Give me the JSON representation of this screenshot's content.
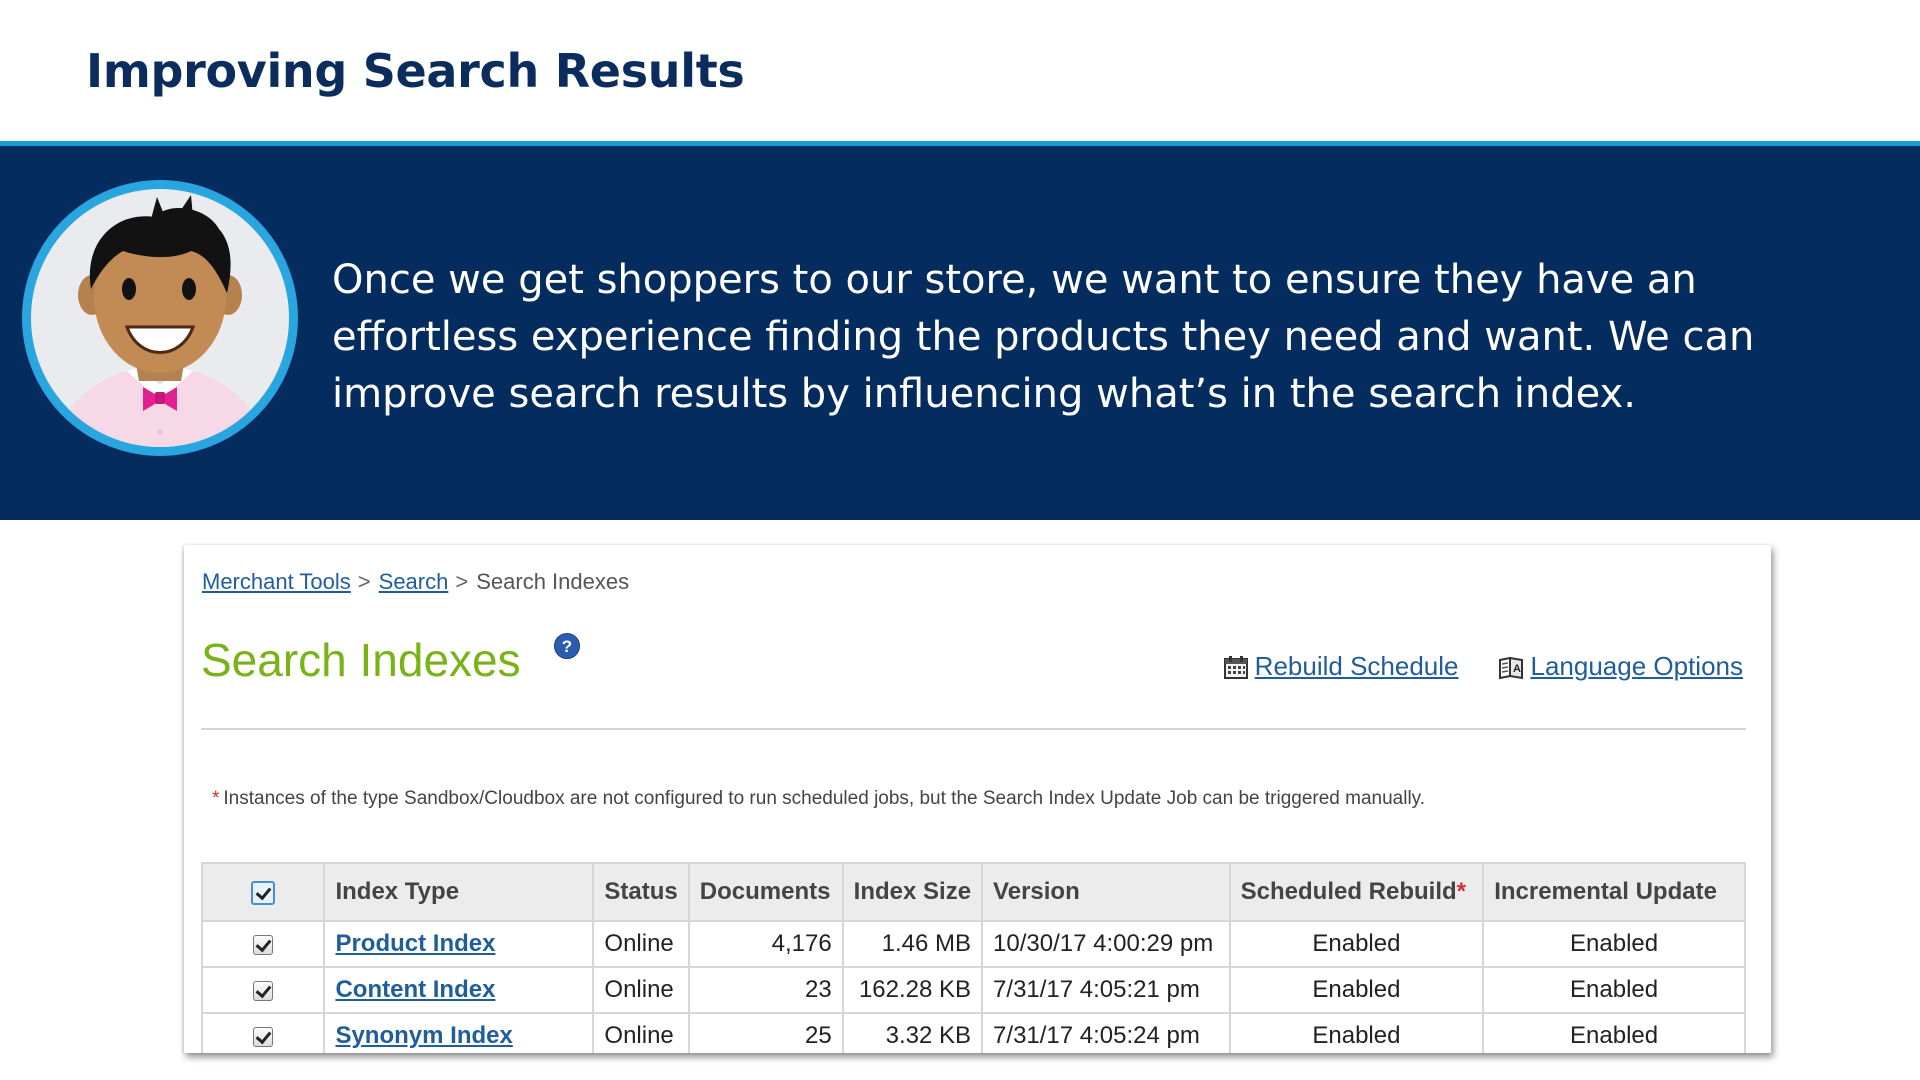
{
  "slide": {
    "title": "Improving Search Results",
    "banner_text": "Once we get shoppers to our store, we want to ensure they have an effortless experience finding the products they need and want. We can improve search results by influencing what’s in the search index."
  },
  "panel": {
    "breadcrumb": {
      "items": [
        "Merchant Tools",
        "Search"
      ],
      "current": "Search Indexes",
      "separator": ">"
    },
    "page_title": "Search Indexes",
    "help_icon": "?",
    "links": {
      "rebuild_schedule": "Rebuild Schedule",
      "rebuild_icon": "calendar-icon",
      "language_options": "Language Options",
      "language_icon": "language-book-icon"
    },
    "note_star": "*",
    "note": "Instances of the type Sandbox/Cloudbox are not configured to run scheduled jobs, but the Search Index Update Job can be triggered manually.",
    "table": {
      "headers": {
        "index_type": "Index Type",
        "status": "Status",
        "documents": "Documents",
        "index_size": "Index Size",
        "version": "Version",
        "scheduled_rebuild": "Scheduled Rebuild",
        "scheduled_rebuild_marker": "*",
        "incremental_update": "Incremental Update"
      },
      "rows": [
        {
          "index_type": "Product Index",
          "status": "Online",
          "documents": "4,176",
          "index_size": "1.46 MB",
          "version": "10/30/17 4:00:29 pm",
          "scheduled_rebuild": "Enabled",
          "incremental_update": "Enabled"
        },
        {
          "index_type": "Content Index",
          "status": "Online",
          "documents": "23",
          "index_size": "162.28 KB",
          "version": "7/31/17 4:05:21 pm",
          "scheduled_rebuild": "Enabled",
          "incremental_update": "Enabled"
        },
        {
          "index_type": "Synonym Index",
          "status": "Online",
          "documents": "25",
          "index_size": "3.32 KB",
          "version": "7/31/17 4:05:24 pm",
          "scheduled_rebuild": "Enabled",
          "incremental_update": "Enabled"
        }
      ]
    }
  },
  "colors": {
    "title_navy": "#0a2d5e",
    "banner_bg": "#052c5f",
    "accent_blue": "#1c9ad6",
    "heading_green": "#7ab317",
    "link_blue": "#1f5d9c"
  }
}
